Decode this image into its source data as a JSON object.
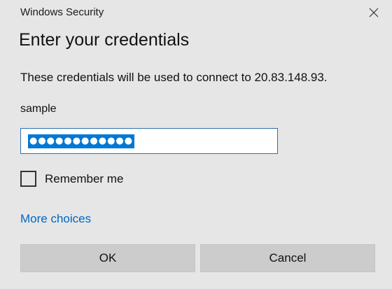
{
  "window": {
    "title": "Windows Security",
    "close_icon": "close-icon"
  },
  "dialog": {
    "heading": "Enter your credentials",
    "description": "These credentials will be used to connect to 20.83.148.93.",
    "username": "sample",
    "password_mask": "●●●●●●●●●●●●",
    "password_selected": true,
    "remember_label": "Remember me",
    "remember_checked": false,
    "more_choices": "More choices",
    "ok_label": "OK",
    "cancel_label": "Cancel"
  },
  "colors": {
    "background": "#e6e6e6",
    "selection": "#0078d7",
    "link": "#0067c0",
    "button": "#cccccc",
    "input_border": "#2f6fb0"
  }
}
